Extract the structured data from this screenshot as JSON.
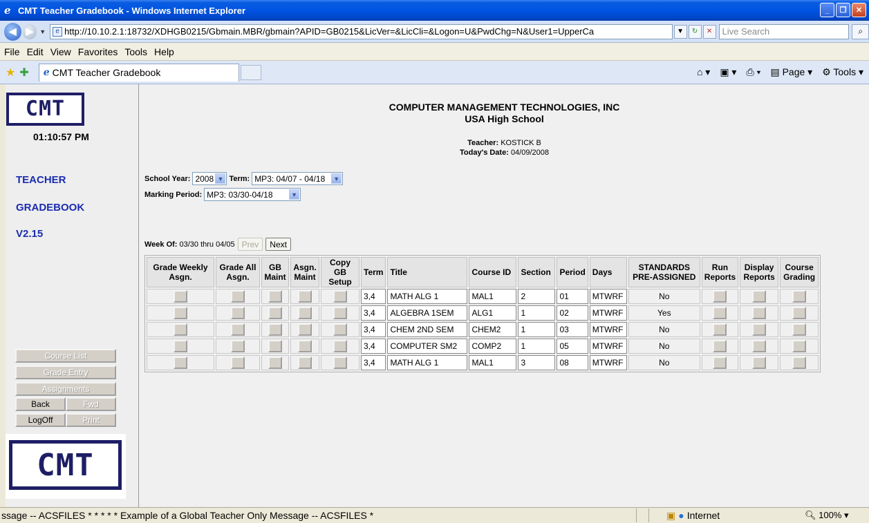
{
  "window": {
    "title": "CMT Teacher Gradebook - Windows Internet Explorer"
  },
  "address": {
    "url": "http://10.10.2.1:18732/XDHGB0215/Gbmain.MBR/gbmain?APID=GB0215&LicVer=&LicCli=&Logon=U&PwdChg=N&User1=UpperCa",
    "search_placeholder": "Live Search"
  },
  "menu": [
    "File",
    "Edit",
    "View",
    "Favorites",
    "Tools",
    "Help"
  ],
  "tab": {
    "label": "CMT Teacher Gradebook"
  },
  "commands": {
    "page": "Page",
    "tools": "Tools"
  },
  "sidebar": {
    "logo_text": "CMT",
    "clock": "01:10:57 PM",
    "title1": "TEACHER",
    "title2": "GRADEBOOK",
    "version": "V2.15",
    "buttons": {
      "course_list": "Course List",
      "grade_entry": "Grade Entry",
      "assignments": "Assignments",
      "back": "Back",
      "fwd": "Fwd",
      "logoff": "LogOff",
      "print": "Print"
    }
  },
  "header": {
    "company": "COMPUTER MANAGEMENT TECHNOLOGIES, INC",
    "school": "USA High School",
    "teacher_label": "Teacher:",
    "teacher": "KOSTICK B",
    "date_label": "Today's Date:",
    "date": "04/09/2008"
  },
  "filters": {
    "school_year_label": "School Year:",
    "school_year": "2008",
    "term_label": "Term:",
    "term": "MP3: 04/07 - 04/18",
    "marking_period_label": "Marking Period:",
    "marking_period": "MP3: 03/30-04/18"
  },
  "week": {
    "label": "Week Of:",
    "range": "03/30 thru 04/05",
    "prev": "Prev",
    "next": "Next"
  },
  "table": {
    "headers": {
      "grade_weekly": [
        "Grade Weekly",
        "Asgn."
      ],
      "grade_all": [
        "Grade All",
        "Asgn."
      ],
      "gb_maint": [
        "GB",
        "Maint"
      ],
      "asgn_maint": [
        "Asgn.",
        "Maint"
      ],
      "copy_gb": [
        "Copy GB",
        "Setup"
      ],
      "term": "Term",
      "title": "Title",
      "course_id": "Course ID",
      "section": "Section",
      "period": "Period",
      "days": "Days",
      "standards": [
        "STANDARDS",
        "PRE-ASSIGNED"
      ],
      "run_reports": [
        "Run",
        "Reports"
      ],
      "display_reports": [
        "Display",
        "Reports"
      ],
      "course_grading": [
        "Course",
        "Grading"
      ]
    },
    "rows": [
      {
        "term": "3,4",
        "title": "MATH ALG 1",
        "course_id": "MAL1",
        "section": "2",
        "period": "01",
        "days": "MTWRF",
        "standards": "No"
      },
      {
        "term": "3,4",
        "title": "ALGEBRA 1SEM",
        "course_id": "ALG1",
        "section": "1",
        "period": "02",
        "days": "MTWRF",
        "standards": "Yes"
      },
      {
        "term": "3,4",
        "title": "CHEM 2ND SEM",
        "course_id": "CHEM2",
        "section": "1",
        "period": "03",
        "days": "MTWRF",
        "standards": "No"
      },
      {
        "term": "3,4",
        "title": "COMPUTER SM2",
        "course_id": "COMP2",
        "section": "1",
        "period": "05",
        "days": "MTWRF",
        "standards": "No"
      },
      {
        "term": "3,4",
        "title": "MATH ALG 1",
        "course_id": "MAL1",
        "section": "3",
        "period": "08",
        "days": "MTWRF",
        "standards": "No"
      }
    ]
  },
  "status": {
    "message": "ssage -- ACSFILES     *     *     *     *     *     Example of a Global Teacher Only Message -- ACSFILES     *",
    "zone": "Internet",
    "zoom": "100%"
  }
}
